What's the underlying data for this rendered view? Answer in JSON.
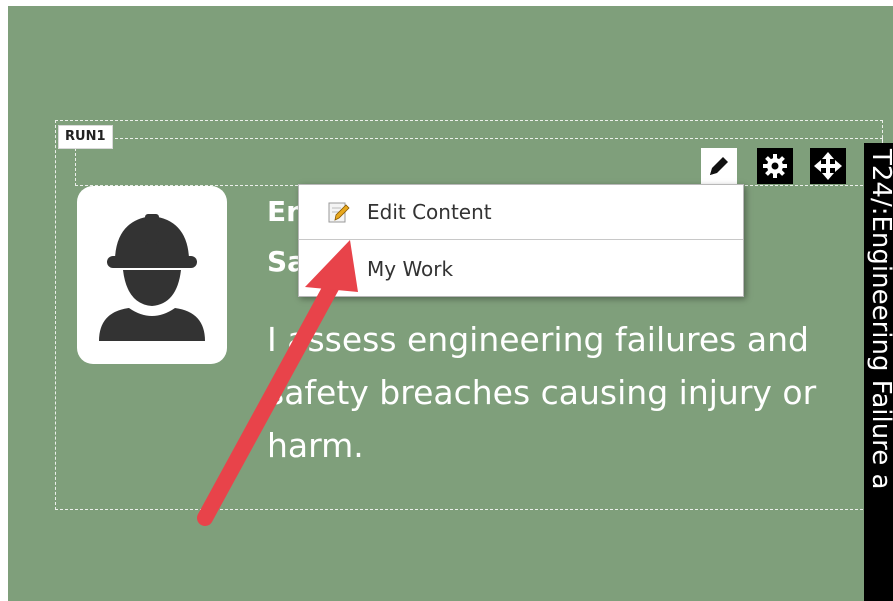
{
  "editor": {
    "run_label": "RUN1",
    "side_panel_text": "T24/:Engineering Failure a"
  },
  "card": {
    "icon": "worker-hardhat-icon",
    "headline_line1": "En",
    "headline_line2": "Sa",
    "description": "I assess engineering failures and safety breaches causing injury or harm."
  },
  "toolbar": {
    "edit_icon": "pencil-icon",
    "settings_icon": "gear-icon",
    "move_icon": "move-arrows-icon"
  },
  "context_menu": {
    "items": [
      {
        "label": "Edit Content",
        "icon": "edit-content-icon"
      },
      {
        "label": "My Work",
        "icon": "my-work-icon"
      }
    ]
  },
  "colors": {
    "background": "#7f9f7b",
    "arrow": "#e8434a"
  }
}
